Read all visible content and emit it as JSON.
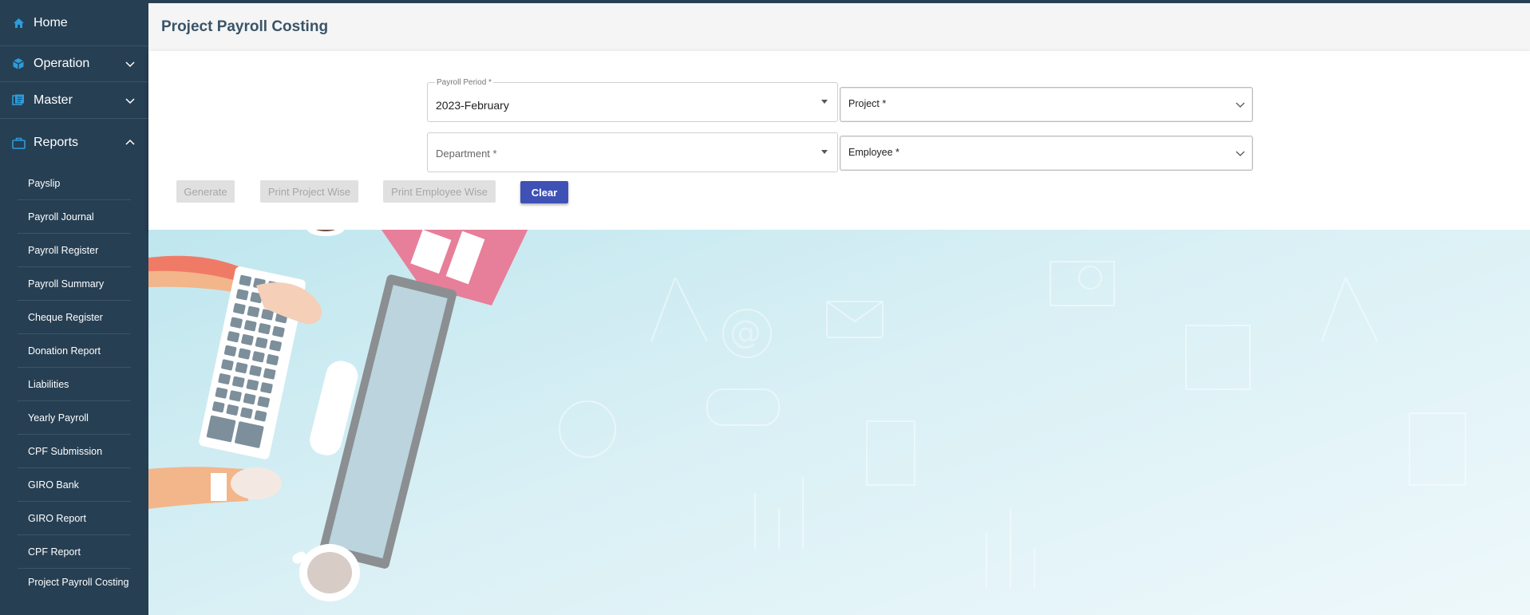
{
  "sidebar": {
    "items": [
      {
        "label": "Home",
        "icon": "home-icon"
      },
      {
        "label": "Operation",
        "icon": "cube-icon"
      },
      {
        "label": "Master",
        "icon": "book-icon"
      },
      {
        "label": "Reports",
        "icon": "briefcase-icon"
      }
    ],
    "reports_sub": [
      "Payslip",
      "Payroll Journal",
      "Payroll Register",
      "Payroll Summary",
      "Cheque Register",
      "Donation Report",
      "Liabilities",
      "Yearly Payroll",
      "CPF Submission",
      "GIRO Bank",
      "GIRO Report",
      "CPF Report",
      "Project Payroll Costing"
    ]
  },
  "header": {
    "title": "Project Payroll Costing"
  },
  "form": {
    "payroll_period": {
      "label": "Payroll Period *",
      "value": "2023-February"
    },
    "project": {
      "label": "Project *"
    },
    "department": {
      "label": "Department *"
    },
    "employee": {
      "label": "Employee *"
    }
  },
  "buttons": {
    "generate": "Generate",
    "print_project": "Print Project Wise",
    "print_employee": "Print Employee Wise",
    "clear": "Clear"
  },
  "colors": {
    "sidebar_bg": "#263f53",
    "accent_icon": "#2d9cdb",
    "primary_button": "#3f51b5",
    "title_text": "#3a5468"
  }
}
